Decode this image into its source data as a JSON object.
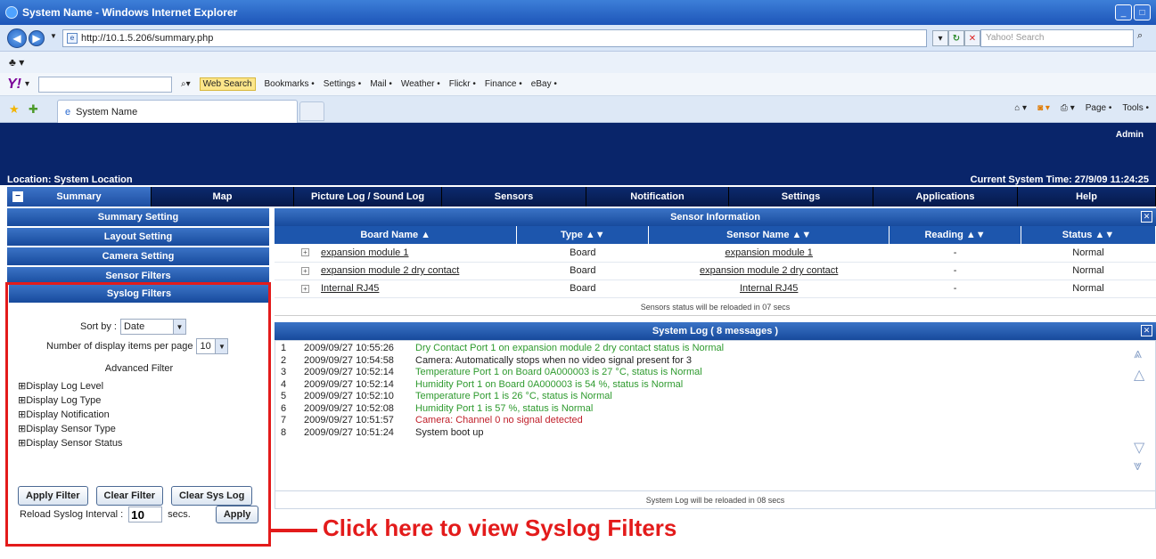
{
  "browser": {
    "window_title": "System Name - Windows Internet Explorer",
    "url": "http://10.1.5.206/summary.php",
    "search_placeholder": "Yahoo! Search",
    "tab_title": "System Name",
    "yahoo_toolbar": {
      "web_search": "Web Search",
      "items": [
        "Bookmarks •",
        "Settings •",
        "Mail •",
        "Weather •",
        "Flickr •",
        "Finance •",
        "eBay •"
      ]
    },
    "command_bar": [
      "Page •",
      "Tools •"
    ]
  },
  "header": {
    "user": "Admin",
    "location": "Location: System Location",
    "system_time": "Current System Time: 27/9/09 11:24:25"
  },
  "nav_tabs": [
    "Summary",
    "Map",
    "Picture Log / Sound Log",
    "Sensors",
    "Notification",
    "Settings",
    "Applications",
    "Help"
  ],
  "left_menu": [
    "Summary Setting",
    "Layout Setting",
    "Camera Setting",
    "Sensor Filters"
  ],
  "syslog_filters": {
    "title": "Syslog Filters",
    "sort_by_label": "Sort by :",
    "sort_by_value": "Date",
    "per_page_label": "Number of display items per page",
    "per_page_value": "10",
    "advanced_title": "Advanced Filter",
    "filters": [
      "Display Log Level",
      "Display Log Type",
      "Display Notification",
      "Display Sensor Type",
      "Display Sensor Status"
    ],
    "apply_filter": "Apply Filter",
    "clear_filter": "Clear Filter",
    "clear_syslog": "Clear Sys Log",
    "reload_label": "Reload Syslog Interval :",
    "reload_value": "10",
    "reload_unit": "secs.",
    "apply": "Apply"
  },
  "sensor_info": {
    "title": "Sensor Information",
    "columns": [
      "Board Name ▲",
      "Type ▲▼",
      "Sensor Name ▲▼",
      "Reading ▲▼",
      "Status ▲▼"
    ],
    "rows": [
      {
        "board": "expansion module 1",
        "type": "Board",
        "sensor": "expansion module 1",
        "reading": "-",
        "status": "Normal"
      },
      {
        "board": "expansion module 2 dry contact",
        "type": "Board",
        "sensor": "expansion module 2 dry contact",
        "reading": "-",
        "status": "Normal"
      },
      {
        "board": "Internal RJ45",
        "type": "Board",
        "sensor": "Internal RJ45",
        "reading": "-",
        "status": "Normal"
      }
    ],
    "reload_note": "Sensors status will be reloaded in 07 secs"
  },
  "system_log": {
    "title": "System Log ( 8 messages )",
    "entries": [
      {
        "n": "1",
        "time": "2009/09/27 10:55:26",
        "msg": "Dry Contact Port 1 on expansion module 2 dry contact status is Normal",
        "color": "#2e9a2e"
      },
      {
        "n": "2",
        "time": "2009/09/27 10:54:58",
        "msg": "Camera: Automatically stops when no video signal present for 3",
        "color": "#222222"
      },
      {
        "n": "3",
        "time": "2009/09/27 10:52:14",
        "msg": "Temperature Port 1 on Board 0A000003 is 27 °C, status is Normal",
        "color": "#2e9a2e"
      },
      {
        "n": "4",
        "time": "2009/09/27 10:52:14",
        "msg": "Humidity Port 1 on Board 0A000003 is 54 %, status is Normal",
        "color": "#2e9a2e"
      },
      {
        "n": "5",
        "time": "2009/09/27 10:52:10",
        "msg": "Temperature Port 1 is 26 °C, status is Normal",
        "color": "#2e9a2e"
      },
      {
        "n": "6",
        "time": "2009/09/27 10:52:08",
        "msg": "Humidity Port 1 is 57 %, status is Normal",
        "color": "#2e9a2e"
      },
      {
        "n": "7",
        "time": "2009/09/27 10:51:57",
        "msg": "Camera: Channel 0 no signal detected",
        "color": "#c0202a"
      },
      {
        "n": "8",
        "time": "2009/09/27 10:51:24",
        "msg": "System boot up",
        "color": "#222222"
      }
    ],
    "reload_note": "System Log will be reloaded in 08 secs"
  },
  "annotation": "Click here to view Syslog Filters",
  "colors": {
    "accent_red": "#e31b1b",
    "header_navy": "#09256a",
    "panel_blue": "#1d56ad"
  }
}
